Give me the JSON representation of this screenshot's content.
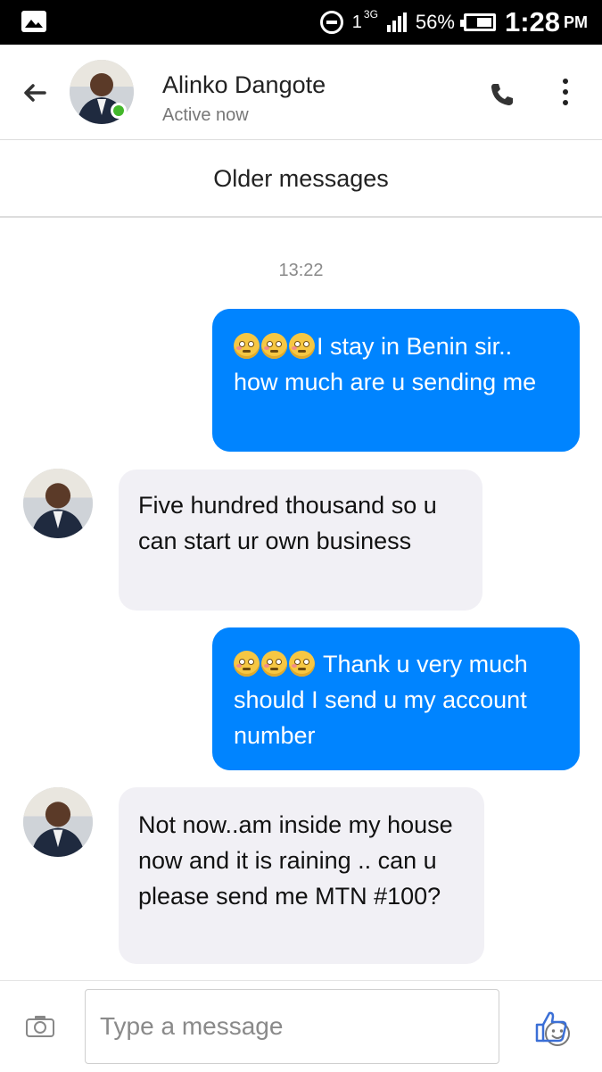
{
  "status_bar": {
    "network_type": "3G",
    "sim_label": "1",
    "battery_percent": "56%",
    "time": "1:28",
    "ampm": "PM"
  },
  "header": {
    "contact_name": "Alinko Dangote",
    "contact_status": "Active now"
  },
  "older_messages_label": "Older messages",
  "timestamp": "13:22",
  "messages": [
    {
      "direction": "outgoing",
      "emoji_count": 3,
      "text": "I stay in Benin sir.. how much are u sending me"
    },
    {
      "direction": "incoming",
      "text": "Five hundred thousand so u can start ur own business"
    },
    {
      "direction": "outgoing",
      "emoji_count": 3,
      "text": "Thank u very much should I send u my account number"
    },
    {
      "direction": "incoming",
      "text": "Not now..am inside my house now and it is raining .. can u please send me MTN #100?"
    }
  ],
  "composer": {
    "placeholder": "Type a message"
  },
  "colors": {
    "outgoing_bubble": "#0084ff",
    "incoming_bubble": "#f1f0f5",
    "online_indicator": "#42b72a"
  },
  "icons": [
    "gallery-icon",
    "dnd-icon",
    "signal-icon",
    "battery-icon",
    "back-arrow-icon",
    "phone-icon",
    "more-vertical-icon",
    "camera-icon",
    "emoji-icon",
    "thumbs-up-icon"
  ]
}
